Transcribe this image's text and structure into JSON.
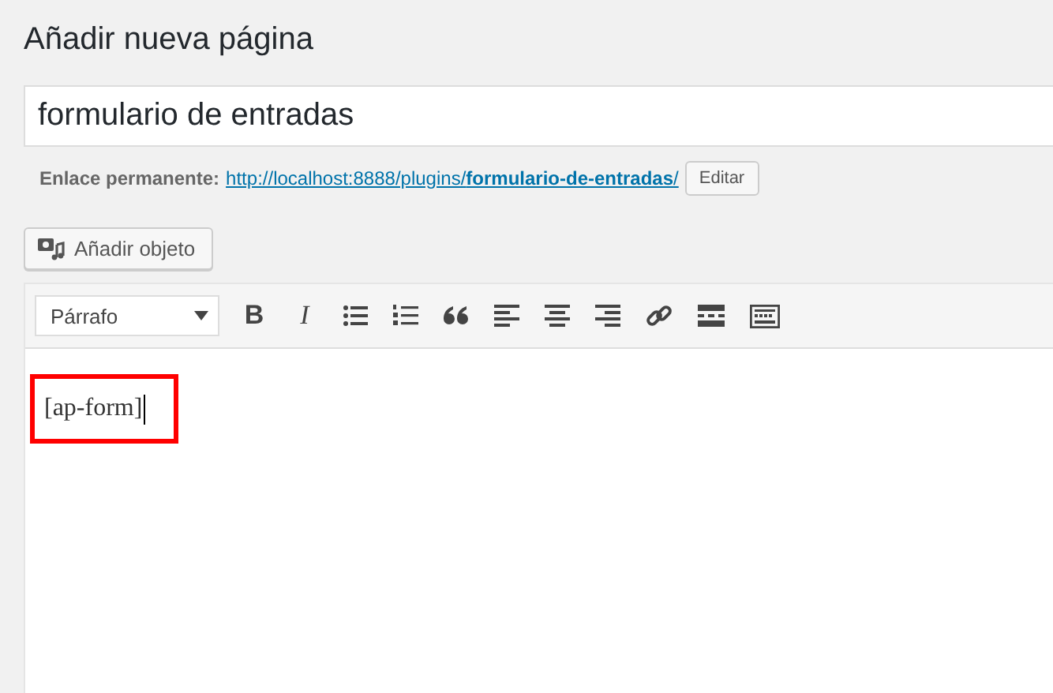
{
  "heading": "Añadir nueva página",
  "title_field": {
    "value": "formulario de entradas"
  },
  "permalink": {
    "label": "Enlace permanente:",
    "url": "http://localhost:8888/plugins/**formulario-de-entradas**/",
    "edit_button": "Editar"
  },
  "media_button": "Añadir objeto",
  "toolbar": {
    "format_select": "Párrafo",
    "buttons": [
      {
        "kind": "bold",
        "label": "B"
      },
      {
        "kind": "italic",
        "label": "I"
      },
      {
        "kind": "bullet-list"
      },
      {
        "kind": "numbered-list"
      },
      {
        "kind": "quote"
      },
      {
        "kind": "align-left"
      },
      {
        "kind": "align-center"
      },
      {
        "kind": "align-right"
      },
      {
        "kind": "link"
      },
      {
        "kind": "read-more"
      },
      {
        "kind": "toolbar-toggle"
      }
    ]
  },
  "editor": {
    "content": "[ap-form]",
    "highlighted": true
  }
}
